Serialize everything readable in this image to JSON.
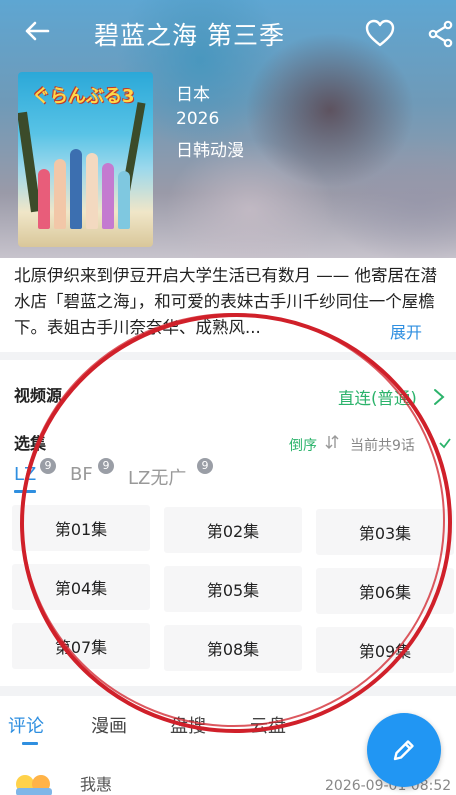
{
  "header": {
    "title": "碧蓝之海 第三季",
    "country": "日本",
    "year": "2026",
    "genre": "日韩动漫",
    "poster_logo": "ぐらんぶる3"
  },
  "synopsis": {
    "text": "北原伊织来到伊豆开启大学生活已有数月 —— 他寄居在潜水店「碧蓝之海」，和可爱的表妹古手川千纱同住一个屋檐下。表姐古手川奈奈华、成熟风...",
    "expand_label": "展开"
  },
  "source": {
    "label": "视频源",
    "value": "直连(普通)"
  },
  "episodes": {
    "label": "选集",
    "order_label": "倒序",
    "total_label": "当前共9话",
    "source_tabs": [
      {
        "label": "LZ",
        "badge": "9"
      },
      {
        "label": "BF",
        "badge": "9"
      },
      {
        "label": "LZ无广",
        "badge": "9"
      }
    ],
    "items": [
      "第01集",
      "第02集",
      "第03集",
      "第04集",
      "第05集",
      "第06集",
      "第07集",
      "第08集",
      "第09集"
    ]
  },
  "bottom_tabs": [
    "评论",
    "漫画",
    "盘搜",
    "云盘"
  ],
  "comment": {
    "username": "我惠",
    "timestamp": "2026-09-01 08:52"
  },
  "colors": {
    "accent_blue": "#2f8fe0",
    "accent_green": "#2cb36b",
    "fab_blue": "#2196f3",
    "annotation_red": "#d0202a"
  },
  "icons": {
    "back": "arrow-left-icon",
    "favorite": "heart-outline-icon",
    "share": "share-icon",
    "source_more": "chevron-right-icon",
    "order": "sort-icon",
    "fab": "pencil-icon"
  }
}
